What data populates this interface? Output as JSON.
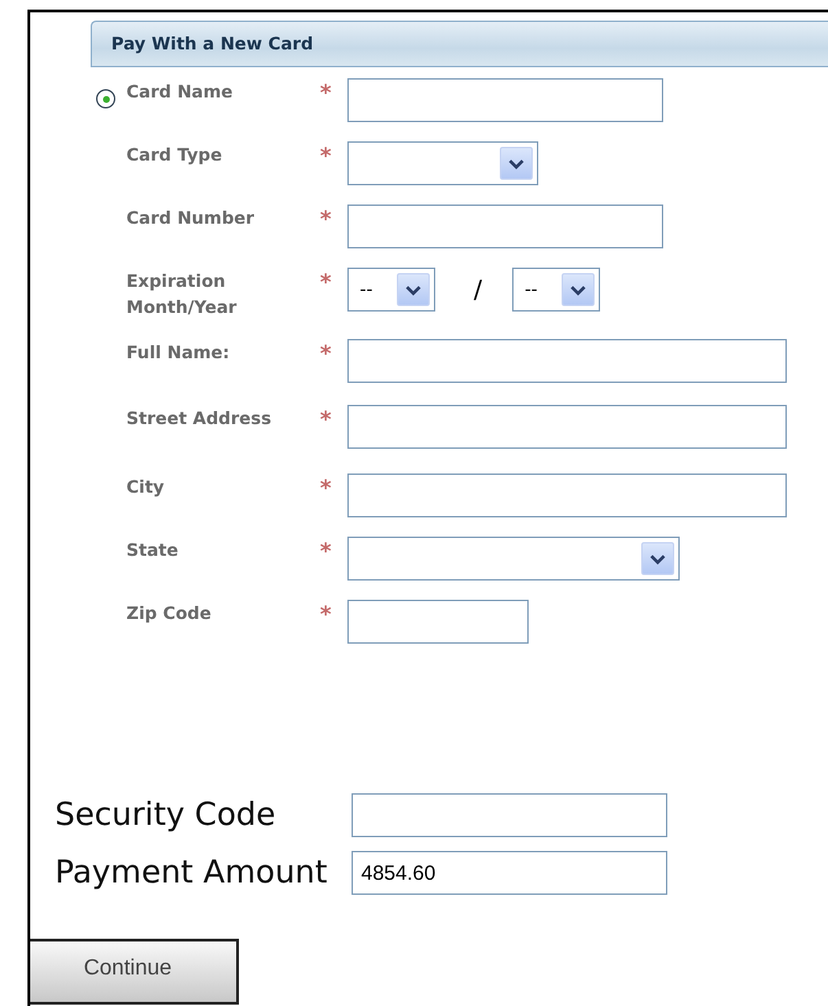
{
  "section": {
    "title": "Pay With a New Card",
    "radio": {
      "selected": true
    }
  },
  "fields": [
    {
      "kind": "text",
      "label": "Card Name",
      "required_mark": "*"
    },
    {
      "kind": "select",
      "label": "Card Type",
      "required_mark": "*"
    },
    {
      "kind": "text",
      "label": "Card Number",
      "required_mark": "*"
    },
    {
      "kind": "expiry",
      "label": "Expiration Month/Year",
      "required_mark": "*",
      "month": "--",
      "separator": "/",
      "year": "--"
    },
    {
      "kind": "text",
      "label": "Full Name:",
      "required_mark": "*"
    },
    {
      "kind": "text",
      "label": "Street Address",
      "required_mark": "*"
    },
    {
      "kind": "text",
      "label": "City",
      "required_mark": "*"
    },
    {
      "kind": "select",
      "label": "State",
      "required_mark": "*"
    },
    {
      "kind": "text",
      "label": "Zip Code",
      "required_mark": "*"
    }
  ],
  "payment": [
    {
      "label": "Security Code"
    },
    {
      "label": "Payment Amount",
      "value": "4854.60"
    }
  ],
  "buttons": [
    {
      "label": "Continue"
    }
  ]
}
